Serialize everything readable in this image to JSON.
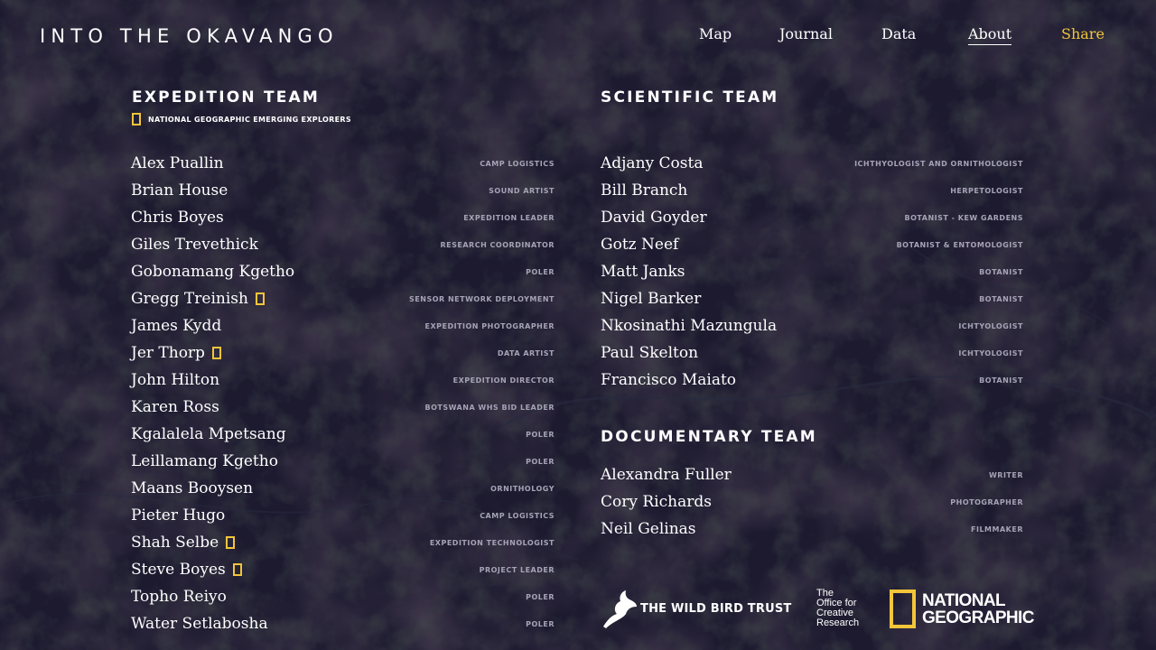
{
  "site": {
    "title": "INTO THE OKAVANGO"
  },
  "nav": [
    {
      "label": "Map",
      "active": false
    },
    {
      "label": "Journal",
      "active": false
    },
    {
      "label": "Data",
      "active": false
    },
    {
      "label": "About",
      "active": true
    },
    {
      "label": "Share",
      "active": false
    }
  ],
  "colors": {
    "accent": "#f2c53a",
    "role": "#a7a3b7",
    "background": "#1f1c30"
  },
  "expedition": {
    "title": "EXPEDITION TEAM",
    "legend": "NATIONAL GEOGRAPHIC EMERGING EXPLORERS",
    "members": [
      {
        "name": "Alex Puallin",
        "role": "CAMP LOGISTICS",
        "explorer": false
      },
      {
        "name": "Brian House",
        "role": "SOUND ARTIST",
        "explorer": false
      },
      {
        "name": "Chris Boyes",
        "role": "EXPEDITION LEADER",
        "explorer": false
      },
      {
        "name": "Giles Trevethick",
        "role": "RESEARCH COORDINATOR",
        "explorer": false
      },
      {
        "name": "Gobonamang Kgetho",
        "role": "POLER",
        "explorer": false
      },
      {
        "name": "Gregg Treinish",
        "role": "SENSOR NETWORK DEPLOYMENT",
        "explorer": true
      },
      {
        "name": "James Kydd",
        "role": "EXPEDITION PHOTOGRAPHER",
        "explorer": false
      },
      {
        "name": "Jer Thorp",
        "role": "DATA ARTIST",
        "explorer": true
      },
      {
        "name": "John Hilton",
        "role": "EXPEDITION DIRECTOR",
        "explorer": false
      },
      {
        "name": "Karen Ross",
        "role": "BOTSWANA WHS BID LEADER",
        "explorer": false
      },
      {
        "name": "Kgalalela Mpetsang",
        "role": "POLER",
        "explorer": false
      },
      {
        "name": "Leillamang Kgetho",
        "role": "POLER",
        "explorer": false
      },
      {
        "name": "Maans Booysen",
        "role": "ORNITHOLOGY",
        "explorer": false
      },
      {
        "name": "Pieter Hugo",
        "role": "CAMP LOGISTICS",
        "explorer": false
      },
      {
        "name": "Shah Selbe",
        "role": "EXPEDITION TECHNOLOGIST",
        "explorer": true
      },
      {
        "name": "Steve Boyes",
        "role": "PROJECT LEADER",
        "explorer": true
      },
      {
        "name": "Topho Reiyo",
        "role": "POLER",
        "explorer": false
      },
      {
        "name": "Water Setlabosha",
        "role": "POLER",
        "explorer": false
      }
    ]
  },
  "scientific": {
    "title": "SCIENTIFIC TEAM",
    "members": [
      {
        "name": "Adjany Costa",
        "role": "ICHTHYOLOGIST AND ORNITHOLOGIST"
      },
      {
        "name": "Bill Branch",
        "role": "HERPETOLOGIST"
      },
      {
        "name": "David Goyder",
        "role": "BOTANIST - KEW GARDENS"
      },
      {
        "name": "Gotz Neef",
        "role": "BOTANIST & ENTOMOLOGIST"
      },
      {
        "name": "Matt Janks",
        "role": "BOTANIST"
      },
      {
        "name": "Nigel Barker",
        "role": "BOTANIST"
      },
      {
        "name": "Nkosinathi Mazungula",
        "role": "ICHTYOLOGIST"
      },
      {
        "name": "Paul Skelton",
        "role": "ICHTYOLOGIST"
      },
      {
        "name": "Francisco Maiato",
        "role": "BOTANIST"
      }
    ]
  },
  "documentary": {
    "title": "DOCUMENTARY TEAM",
    "members": [
      {
        "name": "Alexandra Fuller",
        "role": "WRITER"
      },
      {
        "name": "Cory Richards",
        "role": "PHOTOGRAPHER"
      },
      {
        "name": "Neil Gelinas",
        "role": "FILMMAKER"
      }
    ]
  },
  "partners": {
    "wildbird": "THE WILD BIRD TRUST",
    "ocr": [
      "The",
      "Office for",
      "Creative",
      "Research"
    ],
    "natgeo": [
      "NATIONAL",
      "GEOGRAPHIC"
    ]
  }
}
